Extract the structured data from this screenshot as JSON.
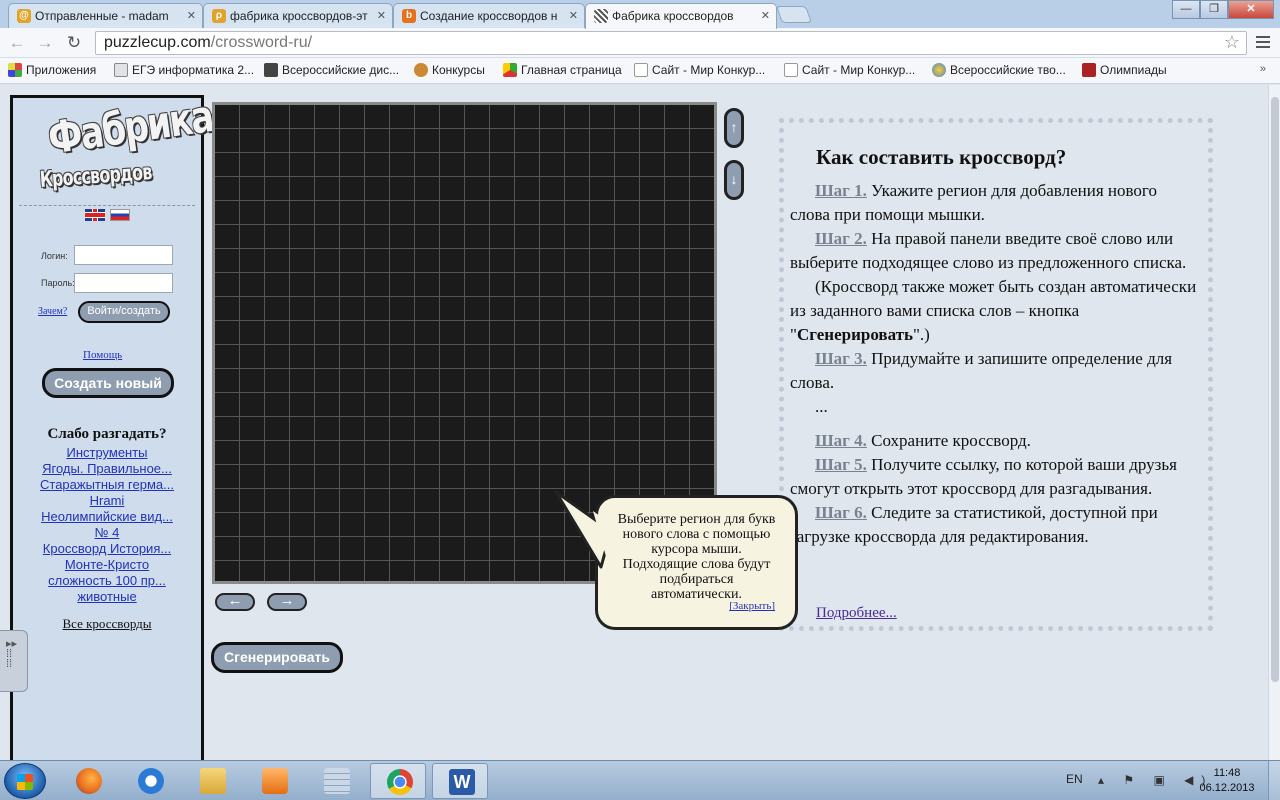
{
  "browser": {
    "tabs": [
      {
        "label": "Отправленные - madam",
        "icon": "mail-icon",
        "color": "#e2a32a"
      },
      {
        "label": "фабрика кроссвордов-эт",
        "icon": "search-icon",
        "color": "#e2a32a"
      },
      {
        "label": "Создание кроссвордов н",
        "icon": "b-icon",
        "color": "#e8701a"
      },
      {
        "label": "Фабрика кроссвордов",
        "icon": "crossword-icon",
        "color": "#555555"
      }
    ],
    "address": {
      "host": "puzzlecup.com",
      "path": "/crossword-ru/"
    },
    "bookmarks": [
      {
        "label": "Приложения",
        "color": "#d44"
      },
      {
        "label": "ЕГЭ информатика 2...",
        "color": "#555"
      },
      {
        "label": "Всероссийские дис...",
        "color": "#444"
      },
      {
        "label": "Конкурсы",
        "color": "#c83"
      },
      {
        "label": "Главная страница",
        "color": "#3a3"
      },
      {
        "label": "Сайт - Мир Конкур...",
        "color": "#ddd"
      },
      {
        "label": "Сайт - Мир Конкур...",
        "color": "#ddd"
      },
      {
        "label": "Всероссийские тво...",
        "color": "#48c"
      },
      {
        "label": "Олимпиады",
        "color": "#a22"
      }
    ]
  },
  "sidebar": {
    "logo_line1": "Фабрика",
    "logo_line2": "Кроссвордов",
    "login_label": "Логин:",
    "password_label": "Пароль:",
    "why_link": "Зачем?",
    "enter_button": "Войти/создать",
    "help_link": "Помощь",
    "create_button": "Создать новый",
    "weak_title": "Слабо разгадать?",
    "weak_list": [
      "Инструменты",
      "Ягоды. Правильное...",
      "Старажытныя герма...",
      "Hrami",
      "Неолимпийские вид...",
      "№ 4",
      "Кроссворд История...",
      "Монте-Кристо",
      "сложность 100 пр...",
      "животные "
    ],
    "all_crosswords": "Все кроссворды"
  },
  "editor": {
    "up_arrow": "↑",
    "down_arrow": "↓",
    "left_arrow": "←",
    "right_arrow": "→",
    "generate_button": "Сгенерировать"
  },
  "help": {
    "title": "Как составить кроссворд?",
    "step1_label": "Шаг 1.",
    "step1_text": " Укажите регион для добавления нового слова при помощи мышки.",
    "step2_label": "Шаг 2.",
    "step2_text": " На правой панели введите своё слово или выберите подходящее слово из предложенного списка.",
    "note_before": "(Кроссворд также может быть создан автоматически из заданного вами списка слов – кнопка \"",
    "note_bold": "Сгенерировать",
    "note_after": "\".)",
    "step3_label": "Шаг 3.",
    "step3_text": " Придумайте и запишите определение для слова.",
    "ellipsis": "...",
    "step4_label": "Шаг 4.",
    "step4_text": " Сохраните кроссворд.",
    "step5_label": "Шаг 5.",
    "step5_text": " Получите ссылку, по которой ваши друзья смогут открыть этот кроссворд для разгадывания.",
    "step6_label": "Шаг 6.",
    "step6_text": " Следите за статистикой, доступной при загрузке кроссворда для редактирования.",
    "more_link": "Подробнее..."
  },
  "tooltip": {
    "text": "Выберите регион для букв нового слова с помощью курсора мыши. Подходящие слова будут подбираться автоматически.",
    "close": "[Закрыть]"
  },
  "taskbar": {
    "lang": "EN",
    "time": "11:48",
    "date": "06.12.2013",
    "apps": [
      {
        "name": "firefox-icon",
        "color": "#e86a1c"
      },
      {
        "name": "internet-explorer-icon",
        "color": "#2a7ad6"
      },
      {
        "name": "explorer-folder-icon",
        "color": "#e6c35a"
      },
      {
        "name": "media-player-icon",
        "color": "#f08a24"
      },
      {
        "name": "calculator-icon",
        "color": "#9bb3cc"
      },
      {
        "name": "chrome-icon",
        "color": "#dd4433"
      },
      {
        "name": "word-icon",
        "color": "#2b5aa6"
      }
    ]
  }
}
